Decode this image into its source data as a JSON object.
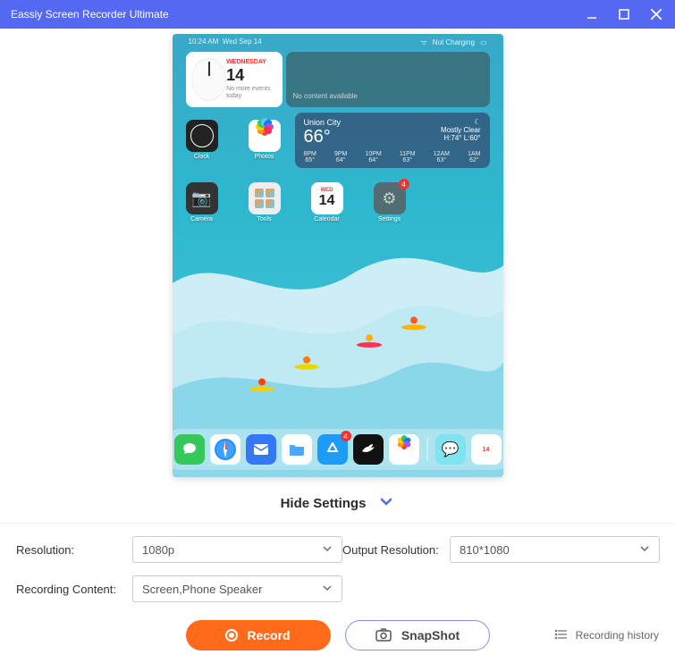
{
  "window": {
    "title": "Eassiy Screen Recorder Ultimate"
  },
  "preview": {
    "status_time": "10:24 AM",
    "status_date": "Wed Sep 14",
    "status_charge": "Not Charging",
    "clock_widget": {
      "day_of_week": "WEDNESDAY",
      "day_num": "14",
      "events": "No more events today"
    },
    "gray_widget": "No content available",
    "weather": {
      "location": "Union City",
      "temp": "66°",
      "condition": "Mostly Clear",
      "hilo": "H:74° L:60°",
      "hours": [
        {
          "t": "8PM",
          "v": "65°"
        },
        {
          "t": "9PM",
          "v": "64°"
        },
        {
          "t": "10PM",
          "v": "64°"
        },
        {
          "t": "11PM",
          "v": "63°"
        },
        {
          "t": "12AM",
          "v": "63°"
        },
        {
          "t": "1AM",
          "v": "62°"
        }
      ]
    },
    "apps_r1": [
      {
        "name": "Clock"
      },
      {
        "name": "Photos"
      }
    ],
    "apps_r2": [
      {
        "name": "Camera"
      },
      {
        "name": "Tools"
      },
      {
        "name": "Calendar",
        "dow": "WED",
        "dn": "14"
      },
      {
        "name": "Settings",
        "badge": "4"
      }
    ],
    "dock_badge": "4"
  },
  "toggle": {
    "label": "Hide Settings"
  },
  "settings": {
    "resolution_label": "Resolution:",
    "resolution_value": "1080p",
    "output_label": "Output Resolution:",
    "output_value": "810*1080",
    "content_label": "Recording Content:",
    "content_value": "Screen,Phone Speaker"
  },
  "buttons": {
    "record": "Record",
    "snapshot": "SnapShot",
    "history": "Recording history"
  }
}
